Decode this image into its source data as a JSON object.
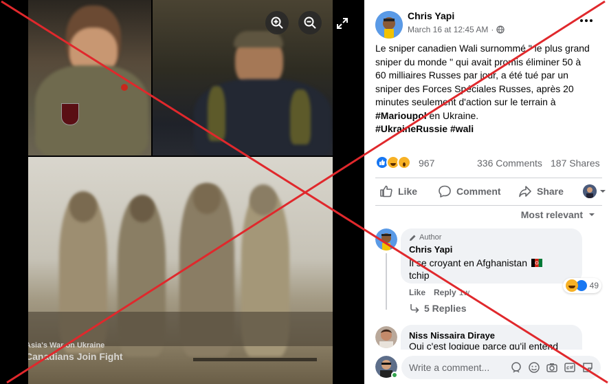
{
  "post": {
    "author": "Chris Yapi",
    "timestamp": "March 16 at 12:45 AM",
    "privacy_sep": "·",
    "text_lines": [
      "Le sniper canadien Wali surnommé \" le plus grand",
      "sniper du monde \" qui avait promis éliminer 50 à",
      "60 milliaires Russes par jour, a été tué par un",
      "sniper des Forces Spéciales Russes, après 20",
      "minutes seulement d'action sur le terrain à"
    ],
    "hashtag_line1": "#Marioupol",
    "text_after_hashtag": " en Ukraine.",
    "hashtags_line2": "#UkraineRussie #wali",
    "reactions_count": "967",
    "comments_count": "336 Comments",
    "shares_count": "187 Shares"
  },
  "actions": {
    "like": "Like",
    "comment": "Comment",
    "share": "Share"
  },
  "sort_label": "Most relevant",
  "comments": [
    {
      "badge": "Author",
      "author": "Chris Yapi",
      "line1": "Il se croyant en Afghanistan",
      "line2": "tchip",
      "reaction_count": "49",
      "like": "Like",
      "reply": "Reply",
      "age": "1w",
      "replies": "5 Replies"
    },
    {
      "author": "Niss Nissaira Diraye",
      "line1": "Oui c'est logique parce qu'il entend"
    }
  ],
  "composer": {
    "placeholder": "Write a comment..."
  },
  "photo": {
    "watermark_line1": "Asia's War on Ukraine",
    "watermark_line2": "Canadians Join Fight"
  },
  "icons": {
    "zoom_in": "zoom-in-icon",
    "zoom_out": "zoom-out-icon",
    "fullscreen": "fullscreen-icon",
    "more": "more-dots-icon"
  },
  "colors": {
    "cross": "#e0282c",
    "like_blue": "#1877f2",
    "haha_yellow": "#f7b125",
    "secondary_text": "#65676b"
  }
}
